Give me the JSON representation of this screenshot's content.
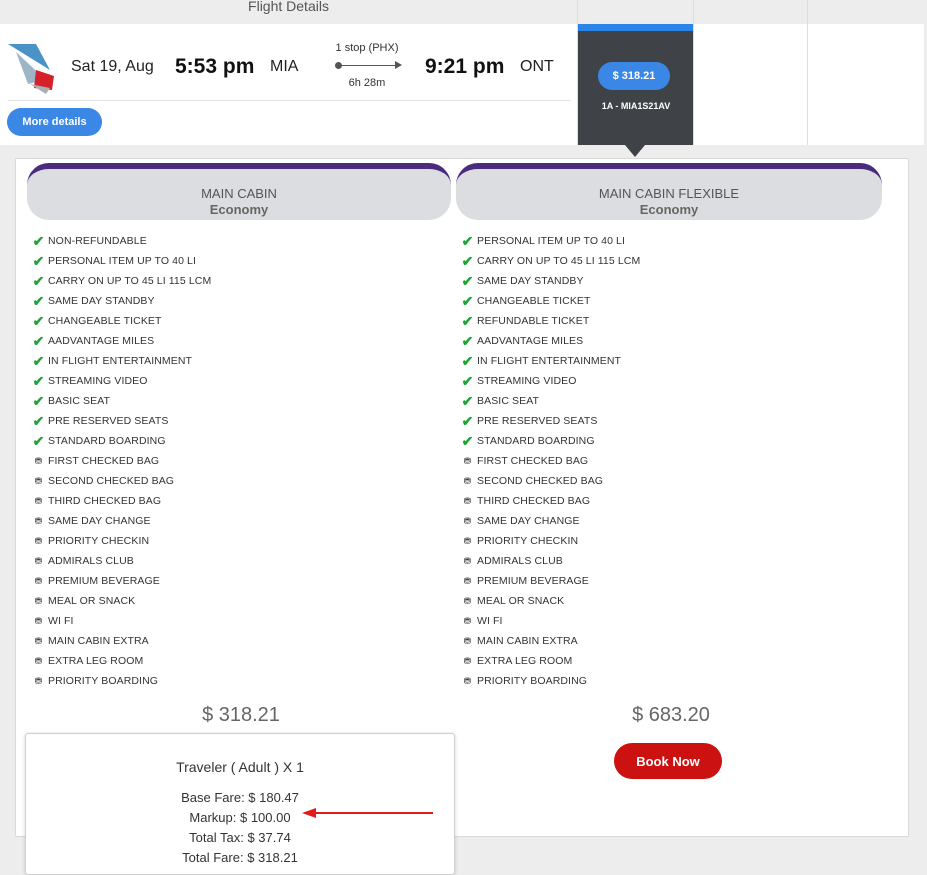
{
  "header": {
    "flight_details_label": "Flight Details"
  },
  "flight": {
    "date": "Sat 19, Aug",
    "departure_time": "5:53 pm",
    "origin": "MIA",
    "stops": "1 stop (PHX)",
    "duration": "6h 28m",
    "arrival_time": "9:21 pm",
    "destination": "ONT",
    "more_details_label": "More details"
  },
  "class_tabs": {
    "economy": {
      "price": "$ 318.21",
      "fare_code": "1A - MIA1S21AV"
    }
  },
  "cabins": [
    {
      "name": "MAIN CABIN",
      "class": "Economy",
      "price": "$ 318.21",
      "features": [
        {
          "text": "NON-REFUNDABLE",
          "included": true
        },
        {
          "text": "PERSONAL ITEM UP TO 40 LI",
          "included": true
        },
        {
          "text": "CARRY ON UP TO 45 LI 115 LCM",
          "included": true
        },
        {
          "text": "SAME DAY STANDBY",
          "included": true
        },
        {
          "text": "CHANGEABLE TICKET",
          "included": true
        },
        {
          "text": "AADVANTAGE MILES",
          "included": true
        },
        {
          "text": "IN FLIGHT ENTERTAINMENT",
          "included": true
        },
        {
          "text": "STREAMING VIDEO",
          "included": true
        },
        {
          "text": "BASIC SEAT",
          "included": true
        },
        {
          "text": "PRE RESERVED SEATS",
          "included": true
        },
        {
          "text": "STANDARD BOARDING",
          "included": true
        },
        {
          "text": "FIRST CHECKED BAG",
          "included": false
        },
        {
          "text": "SECOND CHECKED BAG",
          "included": false
        },
        {
          "text": "THIRD CHECKED BAG",
          "included": false
        },
        {
          "text": "SAME DAY CHANGE",
          "included": false
        },
        {
          "text": "PRIORITY CHECKIN",
          "included": false
        },
        {
          "text": "ADMIRALS CLUB",
          "included": false
        },
        {
          "text": "PREMIUM BEVERAGE",
          "included": false
        },
        {
          "text": "MEAL OR SNACK",
          "included": false
        },
        {
          "text": "WI FI",
          "included": false
        },
        {
          "text": "MAIN CABIN EXTRA",
          "included": false
        },
        {
          "text": "EXTRA LEG ROOM",
          "included": false
        },
        {
          "text": "PRIORITY BOARDING",
          "included": false
        }
      ]
    },
    {
      "name": "MAIN CABIN FLEXIBLE",
      "class": "Economy",
      "price": "$ 683.20",
      "book_label": "Book Now",
      "features": [
        {
          "text": "PERSONAL ITEM UP TO 40 LI",
          "included": true
        },
        {
          "text": "CARRY ON UP TO 45 LI 115 LCM",
          "included": true
        },
        {
          "text": "SAME DAY STANDBY",
          "included": true
        },
        {
          "text": "CHANGEABLE TICKET",
          "included": true
        },
        {
          "text": "REFUNDABLE TICKET",
          "included": true
        },
        {
          "text": "AADVANTAGE MILES",
          "included": true
        },
        {
          "text": "IN FLIGHT ENTERTAINMENT",
          "included": true
        },
        {
          "text": "STREAMING VIDEO",
          "included": true
        },
        {
          "text": "BASIC SEAT",
          "included": true
        },
        {
          "text": "PRE RESERVED SEATS",
          "included": true
        },
        {
          "text": "STANDARD BOARDING",
          "included": true
        },
        {
          "text": "FIRST CHECKED BAG",
          "included": false
        },
        {
          "text": "SECOND CHECKED BAG",
          "included": false
        },
        {
          "text": "THIRD CHECKED BAG",
          "included": false
        },
        {
          "text": "SAME DAY CHANGE",
          "included": false
        },
        {
          "text": "PRIORITY CHECKIN",
          "included": false
        },
        {
          "text": "ADMIRALS CLUB",
          "included": false
        },
        {
          "text": "PREMIUM BEVERAGE",
          "included": false
        },
        {
          "text": "MEAL OR SNACK",
          "included": false
        },
        {
          "text": "WI FI",
          "included": false
        },
        {
          "text": "MAIN CABIN EXTRA",
          "included": false
        },
        {
          "text": "EXTRA LEG ROOM",
          "included": false
        },
        {
          "text": "PRIORITY BOARDING",
          "included": false
        }
      ]
    }
  ],
  "fare_popover": {
    "title": "Traveler ( Adult ) X 1",
    "base_fare": "Base Fare: $ 180.47",
    "markup": "Markup: $ 100.00",
    "total_tax": "Total Tax: $ 37.74",
    "total_fare": "Total Fare: $ 318.21"
  },
  "colors": {
    "accent_blue": "#3a87e6",
    "cabin_border_purple": "#4a2b7e",
    "book_red": "#cc1111",
    "check_green": "#1fa33a",
    "annotation_red": "#e11b1b"
  },
  "icons": {
    "included": "check-icon",
    "paid": "coins-icon"
  }
}
